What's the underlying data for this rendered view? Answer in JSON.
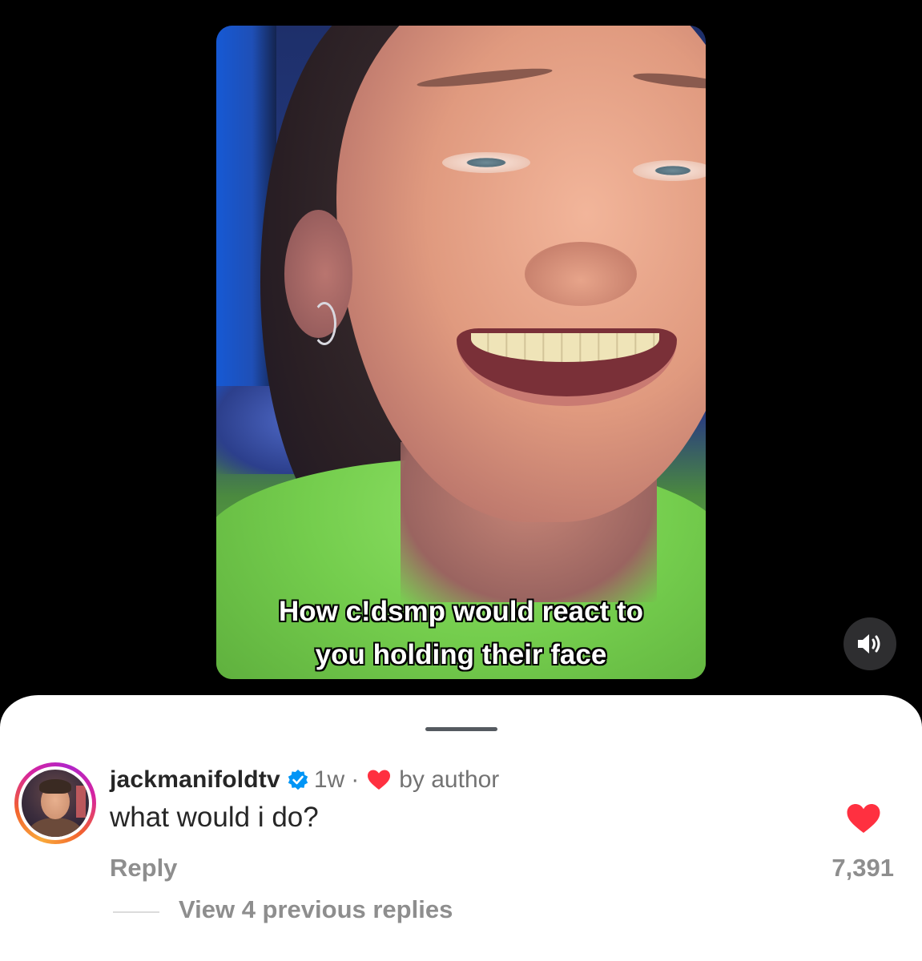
{
  "video": {
    "caption_line1": "How c!dsmp would react to",
    "caption_line2": "you holding their face"
  },
  "controls": {
    "sound_icon": "speaker-on-icon"
  },
  "comment": {
    "username": "jackmanifoldtv",
    "verified_icon": "verified-badge-icon",
    "time": "1w",
    "separator": "·",
    "author_like_icon": "heart-icon",
    "author_like_text": "by author",
    "text": "what would i do?",
    "reply_label": "Reply",
    "like_icon": "heart-icon",
    "like_count": "7,391",
    "view_replies_label": "View 4 previous replies"
  },
  "colors": {
    "heart_red": "#ff3040",
    "verified_blue": "#0095f6",
    "secondary_text": "#8e8e8e",
    "primary_text": "#262626"
  }
}
